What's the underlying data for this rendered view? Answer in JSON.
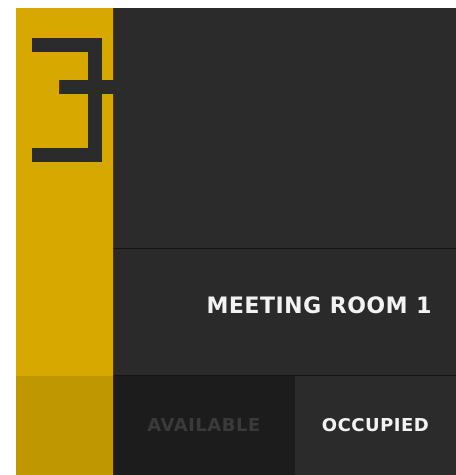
{
  "room": {
    "name": "MEETING ROOM 1"
  },
  "status": {
    "available_label": "AVAILABLE",
    "occupied_label": "OCCUPIED",
    "current": "OCCUPIED"
  },
  "logo": {
    "icon": "bracket-logo-icon"
  },
  "colors": {
    "accent": "#d6a800",
    "panel": "#2b2b2b",
    "text": "#f2f2f2",
    "inactive_text": "#3a3a3a"
  }
}
